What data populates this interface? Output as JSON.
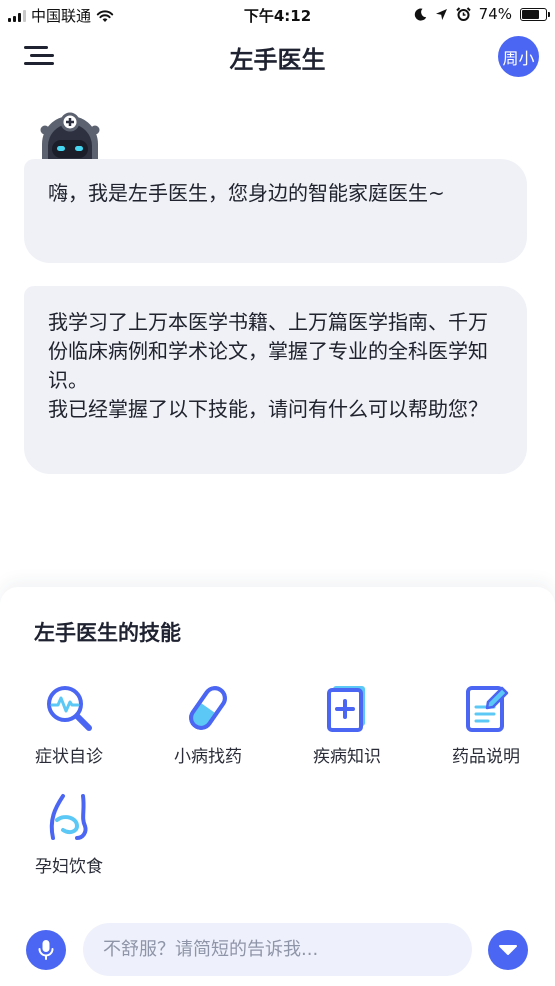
{
  "status_bar": {
    "carrier": "中国联通",
    "time": "下午4:12",
    "battery_percent_label": "74%",
    "battery_level": 0.74,
    "icons": [
      "signal-icon",
      "wifi-icon",
      "moon-icon",
      "location-arrow-icon",
      "alarm-icon",
      "battery-icon"
    ]
  },
  "header": {
    "title": "左手医生",
    "avatar_text": "周小",
    "menu_icon": "menu-icon"
  },
  "chat": {
    "bot_avatar_icon": "robot-doctor-icon",
    "messages": [
      {
        "text": "嗨，我是左手医生，您身边的智能家庭医生~"
      },
      {
        "lines": [
          "我学习了上万本医学书籍、上万篇医学指南、千万份临床病例和学术论文，掌握了专业的全科医学知识。",
          "我已经掌握了以下技能，请问有什么可以帮助您？"
        ]
      }
    ]
  },
  "skills": {
    "heading": "左手医生的技能",
    "items": [
      {
        "label": "症状自诊",
        "icon": "symptom-search-icon"
      },
      {
        "label": "小病找药",
        "icon": "pill-icon"
      },
      {
        "label": "疾病知识",
        "icon": "medical-book-icon"
      },
      {
        "label": "药品说明",
        "icon": "prescription-document-icon"
      },
      {
        "label": "孕妇饮食",
        "icon": "pregnancy-icon"
      }
    ]
  },
  "input": {
    "placeholder": "不舒服？请简短的告诉我...",
    "value": "",
    "mic_icon": "microphone-icon",
    "collapse_icon": "chevron-down-icon"
  },
  "colors": {
    "accent": "#4b66f2",
    "accent_light": "#5bc8f5",
    "bubble_bg": "#eff1f6",
    "input_bg": "#eef1fb",
    "text": "#1f2230"
  }
}
